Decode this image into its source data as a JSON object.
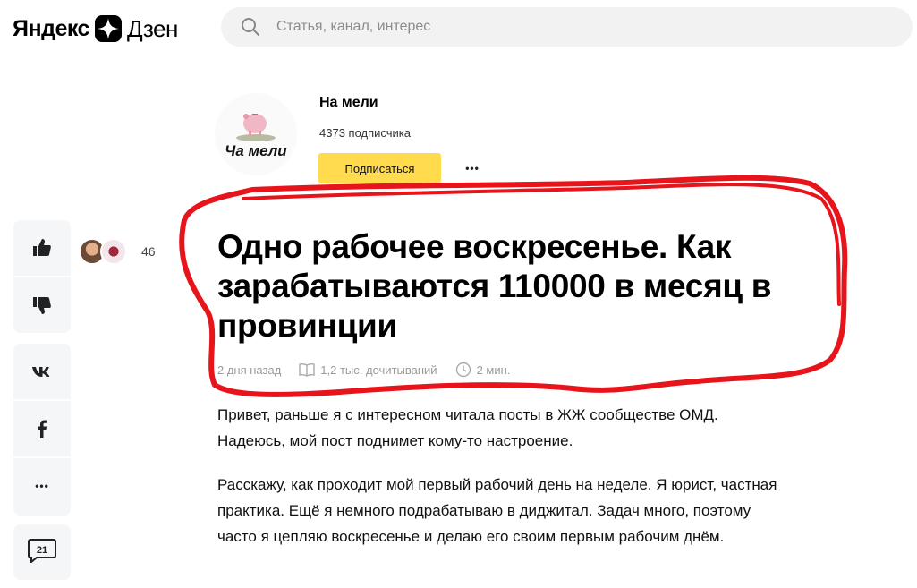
{
  "header": {
    "logo_yandex": "Яндекс",
    "logo_dzen": "Дзен",
    "search_placeholder": "Статья, канал, интерес"
  },
  "channel": {
    "avatar_text": "Ча мели",
    "name": "На мели",
    "subscribers": "4373 подписчика",
    "subscribe_label": "Подписаться",
    "more_label": "•••"
  },
  "sidebar": {
    "likes_count": "46",
    "comments_count": "21",
    "more_label": "•••"
  },
  "article": {
    "title": "Одно рабочее воскресенье. Как зарабатываются 110000 в месяц в провинции",
    "date": "2 дня назад",
    "reads": "1,2 тыс. дочитываний",
    "read_time": "2 мин.",
    "paragraphs": [
      "Привет, раньше я с интересном читала посты в ЖЖ сообществе ОМД. Надеюсь, мой пост поднимет кому-то настроение.",
      "Расскажу, как проходит мой первый рабочий день на неделе. Я юрист, частная практика. Ещё я немного подрабатываю в диджитал. Задач много, поэтому часто я цепляю воскресенье и делаю его своим первым рабочим днём."
    ]
  },
  "colors": {
    "subscribe_bg": "#ffdb4d",
    "sidebar_bg": "#f5f6f8",
    "search_bg": "#f2f2f2",
    "annotation": "#e8141c"
  },
  "icons": [
    "search-icon",
    "dzen-logo-icon",
    "like-icon",
    "dislike-icon",
    "vk-icon",
    "facebook-icon",
    "more-icon",
    "comments-icon",
    "book-icon",
    "clock-icon"
  ]
}
